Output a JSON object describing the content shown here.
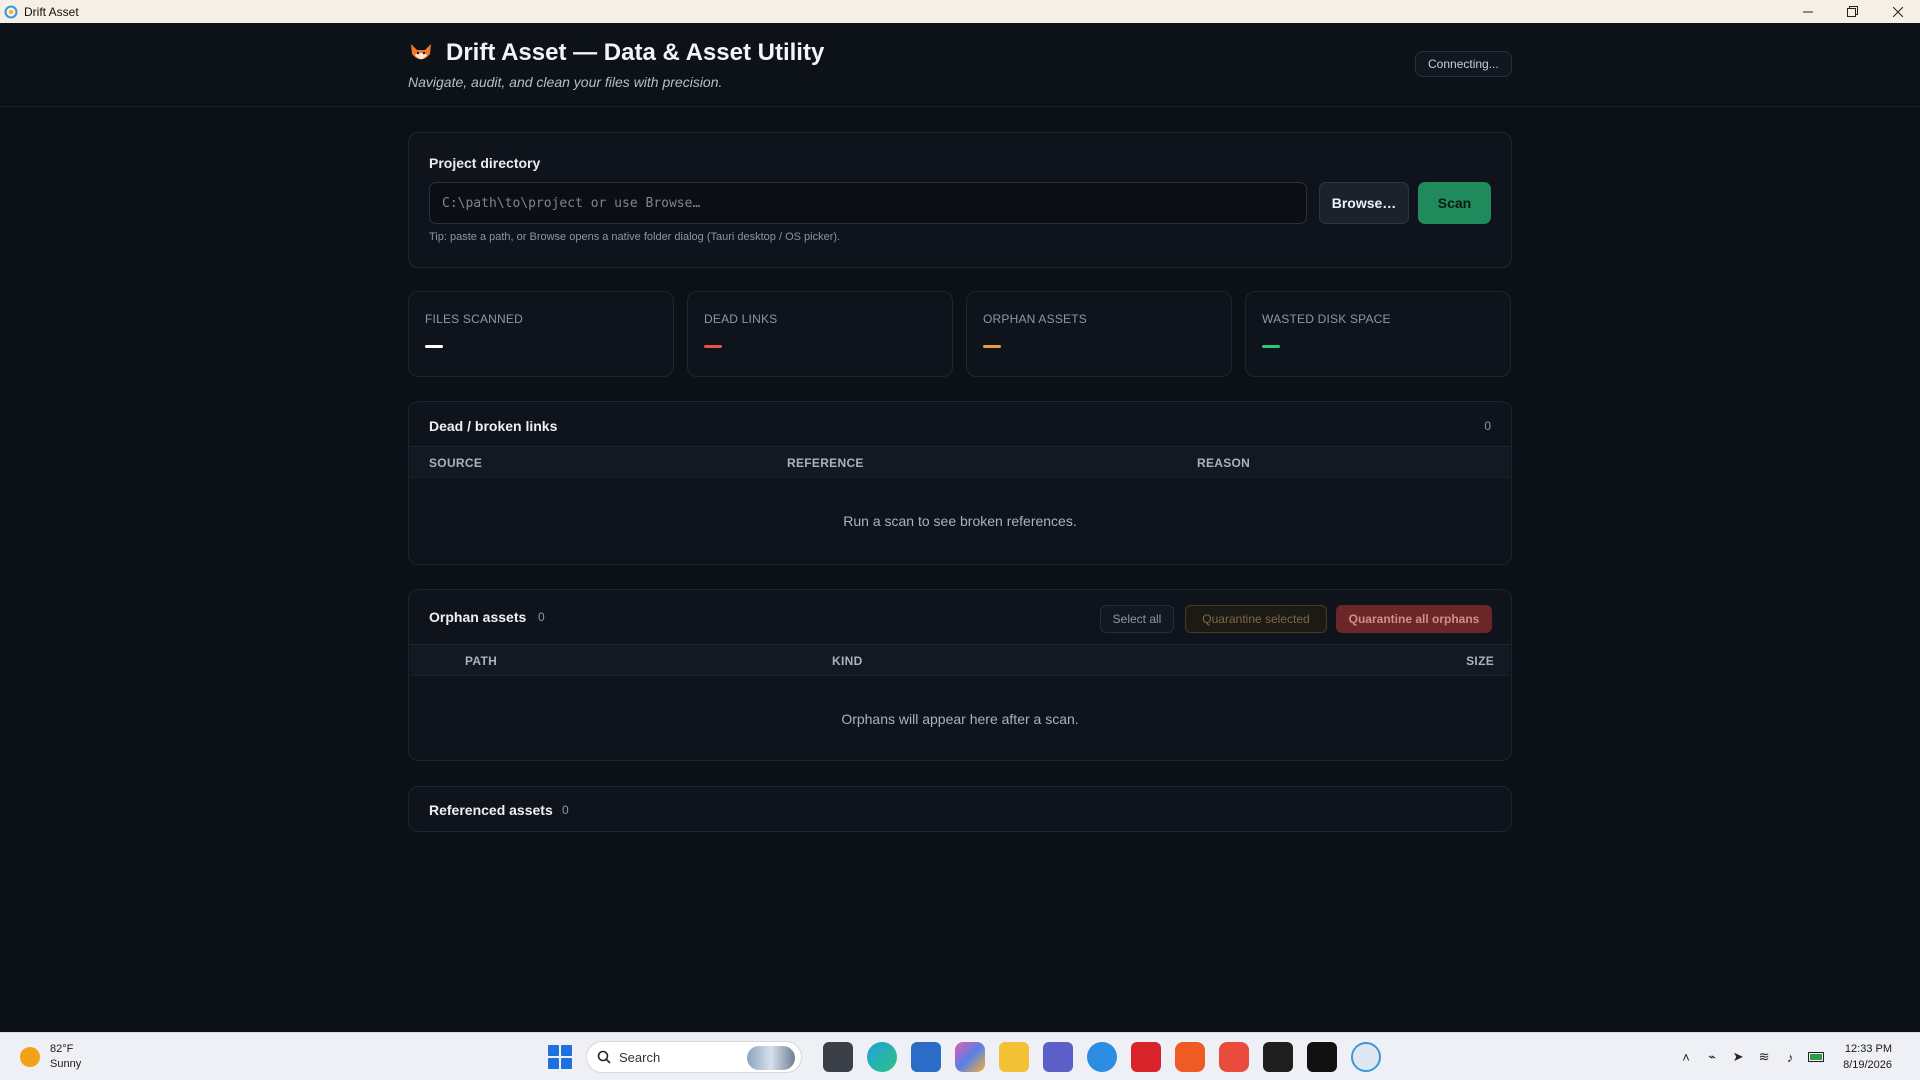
{
  "window": {
    "title": "Drift Asset"
  },
  "header": {
    "title": "Drift Asset — Data & Asset Utility",
    "subtitle": "Navigate, audit, and clean your files with precision.",
    "status": "Connecting..."
  },
  "project": {
    "label": "Project directory",
    "path_value": "",
    "path_placeholder": "C:\\path\\to\\project or use Browse…",
    "browse_label": "Browse…",
    "scan_label": "Scan",
    "tip": "Tip: paste a path, or Browse opens a native folder dialog (Tauri desktop / OS picker)."
  },
  "stats": [
    {
      "label": "FILES SCANNED",
      "color": "#ffffff"
    },
    {
      "label": "DEAD LINKS",
      "color": "#e5534b"
    },
    {
      "label": "ORPHAN ASSETS",
      "color": "#e3a33a"
    },
    {
      "label": "WASTED DISK SPACE",
      "color": "#2fc57a"
    }
  ],
  "dead_links": {
    "title": "Dead / broken links",
    "count": "0",
    "columns": [
      "SOURCE",
      "REFERENCE",
      "REASON"
    ],
    "empty": "Run a scan to see broken references."
  },
  "orphans": {
    "title": "Orphan assets",
    "count": "0",
    "select_all": "Select all",
    "quarantine_selected": "Quarantine selected",
    "quarantine_all": "Quarantine all orphans",
    "columns": [
      "PATH",
      "KIND",
      "SIZE"
    ],
    "empty": "Orphans will appear here after a scan."
  },
  "referenced": {
    "title": "Referenced assets",
    "count": "0"
  },
  "taskbar": {
    "weather_temp": "82°F",
    "weather_desc": "Sunny",
    "search_label": "Search",
    "time": "12:33 PM",
    "date": "8/19/2026"
  }
}
